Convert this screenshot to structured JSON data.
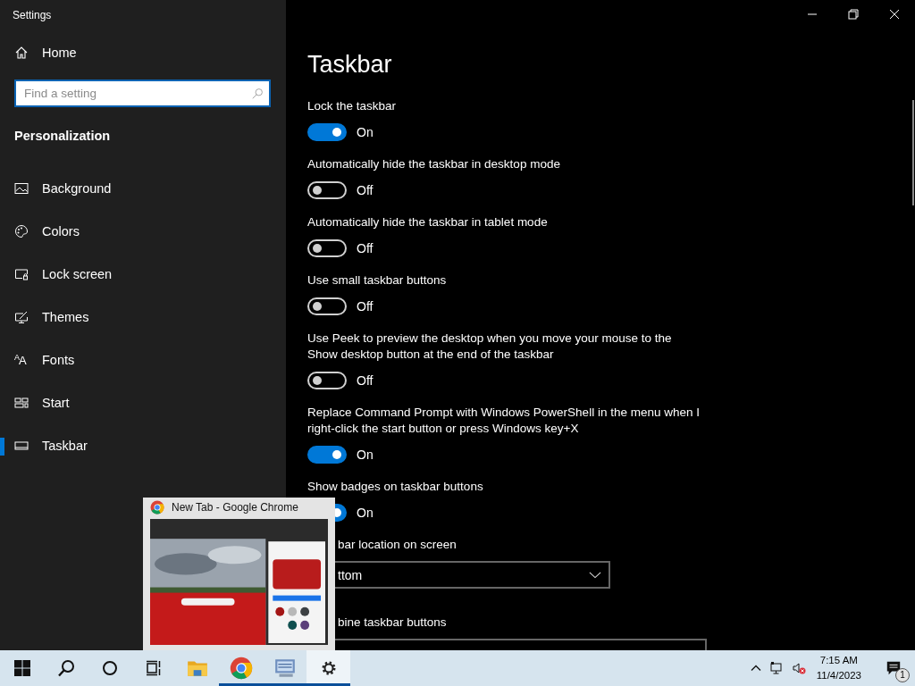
{
  "window": {
    "title": "Settings"
  },
  "sidebar": {
    "home": "Home",
    "search": {
      "placeholder": "Find a setting"
    },
    "section": "Personalization",
    "items": [
      {
        "label": "Background",
        "selected": false
      },
      {
        "label": "Colors",
        "selected": false
      },
      {
        "label": "Lock screen",
        "selected": false
      },
      {
        "label": "Themes",
        "selected": false
      },
      {
        "label": "Fonts",
        "icon_text": "$^{A}$A",
        "selected": false
      },
      {
        "label": "Start",
        "selected": false
      },
      {
        "label": "Taskbar",
        "selected": true
      }
    ]
  },
  "page": {
    "title": "Taskbar",
    "settings": [
      {
        "kind": "toggle",
        "label": "Lock the taskbar",
        "on": true,
        "state": "On"
      },
      {
        "kind": "toggle",
        "label": "Automatically hide the taskbar in desktop mode",
        "on": false,
        "state": "Off"
      },
      {
        "kind": "toggle",
        "label": "Automatically hide the taskbar in tablet mode",
        "on": false,
        "state": "Off"
      },
      {
        "kind": "toggle",
        "label": "Use small taskbar buttons",
        "on": false,
        "state": "Off"
      },
      {
        "kind": "toggle",
        "label": "Use Peek to preview the desktop when you move your mouse to the Show desktop button at the end of the taskbar",
        "on": false,
        "state": "Off"
      },
      {
        "kind": "toggle",
        "label": "Replace Command Prompt with Windows PowerShell in the menu when I right-click the start button or press Windows key+X",
        "on": true,
        "state": "On"
      },
      {
        "kind": "toggle",
        "label": "Show badges on taskbar buttons",
        "on": true,
        "state": "On"
      },
      {
        "kind": "dropdown",
        "label": "bar location on screen",
        "value": "ttom"
      },
      {
        "kind": "dropdown",
        "label": "bine taskbar buttons"
      }
    ]
  },
  "preview": {
    "title": "New Tab - Google Chrome"
  },
  "taskbar": {
    "apps": [
      {
        "kind": "explorer",
        "running": false,
        "selected": false
      },
      {
        "kind": "chrome",
        "running": true,
        "selected": false
      },
      {
        "kind": "monitor",
        "running": true,
        "selected": false
      },
      {
        "kind": "settings",
        "running": true,
        "selected": true
      }
    ],
    "time": "7:15 AM",
    "date": "11/4/2023",
    "notifications": "1"
  }
}
